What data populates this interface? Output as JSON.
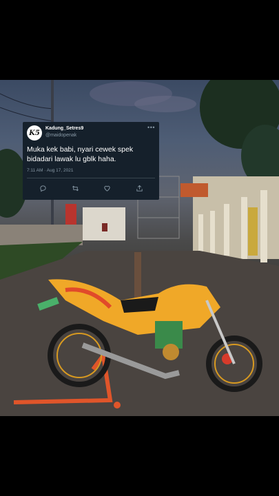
{
  "tweet": {
    "avatar_text": "K5",
    "display_name": "Kadung_Setres9",
    "handle": "@maidopenak",
    "more_icon": "•••",
    "text": "Muka kek babi, nyari cewek spek bidadari lawak lu gblk haha.",
    "timestamp": "7:11 AM · Aug 17, 2021",
    "actions": [
      "reply-icon",
      "retweet-icon",
      "like-icon",
      "share-icon"
    ]
  },
  "colors": {
    "card_bg": "#15202b",
    "secondary_text": "#8899a6",
    "background": "#000000"
  }
}
